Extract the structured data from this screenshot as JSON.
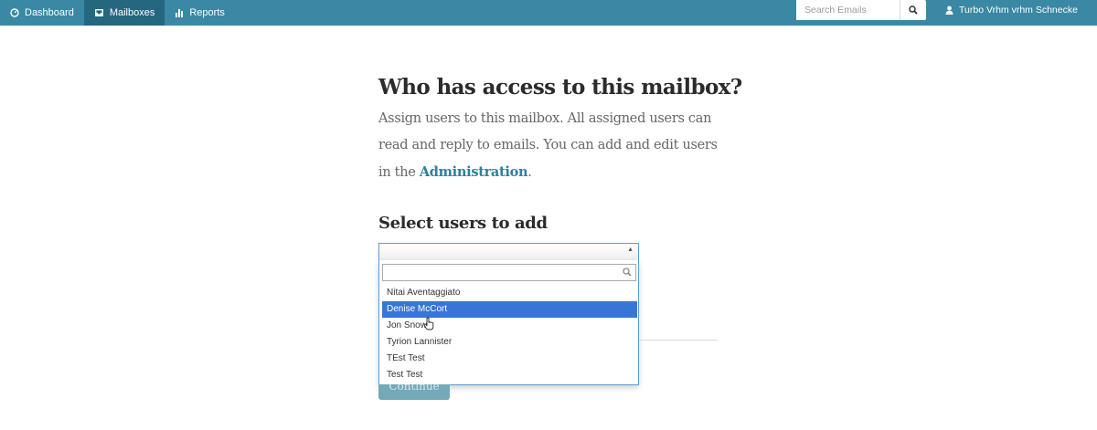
{
  "nav": {
    "items": [
      {
        "label": "Dashboard",
        "icon": "dashboard-icon",
        "active": false
      },
      {
        "label": "Mailboxes",
        "icon": "inbox-icon",
        "active": true
      },
      {
        "label": "Reports",
        "icon": "bar-chart-icon",
        "active": false
      }
    ],
    "search": {
      "placeholder": "Search Emails"
    },
    "user": {
      "name": "Turbo Vrhm vrhm Schnecke",
      "icon": "user-icon"
    }
  },
  "content": {
    "title": "Who has access to this mailbox?",
    "description": "Assign users to this mailbox. All assigned users can read and reply to emails. You can add and edit users in the ",
    "admin_link": "Administration",
    "description_end": ".",
    "select_title": "Select users to add",
    "select_value": "",
    "search_value": "",
    "options": [
      {
        "label": "Nitai Aventaggiato",
        "highlighted": false
      },
      {
        "label": "Denise McCort",
        "highlighted": true
      },
      {
        "label": "Jon Snow",
        "highlighted": false
      },
      {
        "label": "Tyrion Lannister",
        "highlighted": false
      },
      {
        "label": "TEst Test",
        "highlighted": false
      },
      {
        "label": "Test Test",
        "highlighted": false
      }
    ],
    "continue_label": "Continue"
  },
  "colors": {
    "nav_bg": "#3a88a3",
    "nav_active": "#24677f",
    "link": "#2e7f9b",
    "highlight": "#3875d7",
    "button": "#74a9b9"
  }
}
